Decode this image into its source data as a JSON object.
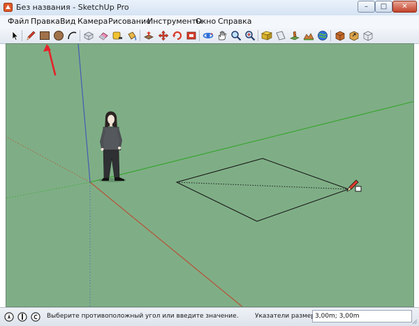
{
  "window": {
    "title": "Без названия - SketchUp Pro",
    "minimize_glyph": "–",
    "maximize_glyph": "□",
    "close_glyph": "✕"
  },
  "menu": {
    "items": [
      "Файл",
      "Правка",
      "Вид",
      "Камера",
      "Рисование",
      "Инструменты",
      "Окно",
      "Справка"
    ]
  },
  "toolbar": {
    "tools": [
      "select-tool-icon",
      "pencil-line-tool-icon",
      "rectangle-tool-icon",
      "circle-tool-icon",
      "arc-tool-icon",
      "eraser-tool-icon",
      "paint-bucket-tool-icon",
      "tape-measure-tool-icon",
      "push-pull-tool-icon",
      "move-tool-icon",
      "rotate-tool-icon",
      "offset-tool-icon",
      "orbit-tool-icon",
      "pan-tool-icon",
      "zoom-tool-icon",
      "zoom-extents-tool-icon",
      "3d-text-tool-icon",
      "section-plane-tool-icon",
      "add-location-tool-icon",
      "toggle-terrain-tool-icon",
      "photo-textures-tool-icon",
      "get-models-tool-icon",
      "share-model-tool-icon",
      "share-component-tool-icon"
    ],
    "active_tool": "rectangle-tool-icon"
  },
  "viewport": {
    "background_color": "#7fae86",
    "axis_colors": {
      "red": "#b4553a",
      "green": "#3ea535",
      "blue": "#4a5fb0"
    },
    "annotation_arrow_color": "#e5232a",
    "cursor": "pencil-rectangle-cursor"
  },
  "status": {
    "icons": [
      "geo-location-icon",
      "credits-icon",
      "help-icon"
    ],
    "message": "Выберите противоположный угол или введите значение.",
    "measurements_label": "Указатели размеров",
    "measurements_value": "3,00m; 3,00m"
  }
}
